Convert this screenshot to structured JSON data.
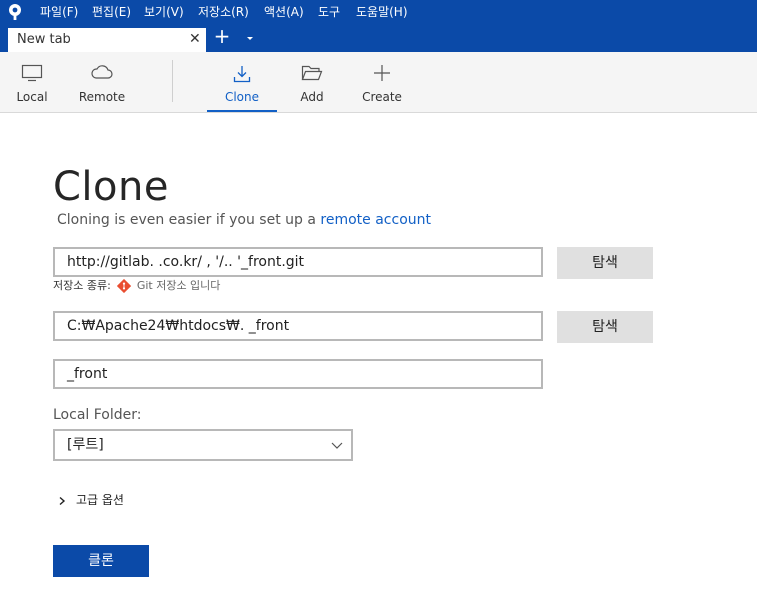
{
  "menu": {
    "file": "파일(F)",
    "edit": "편집(E)",
    "view": "보기(V)",
    "repository": "저장소(R)",
    "actions": "액션(A)",
    "tools": "도구",
    "help": "도움말(H)"
  },
  "tabs": [
    {
      "label": "New tab"
    }
  ],
  "toolbar": {
    "local": "Local",
    "remote": "Remote",
    "clone": "Clone",
    "add": "Add",
    "create": "Create"
  },
  "clone": {
    "title": "Clone",
    "subtitle_text": "Cloning is even easier if you set up a ",
    "subtitle_link": "remote account",
    "source_url": "http://gitlab.      .co.kr/   ,  '/..  '_front.git",
    "browse_label": "탐색",
    "repo_type_label": "저장소 종류:",
    "repo_type_value": "Git 저장소 입니다",
    "destination_path": "C:₩Apache24₩htdocs₩.      _front",
    "name": "       _front",
    "local_folder_label": "Local Folder:",
    "local_folder_value": "[루트]",
    "advanced_options": "고급 옵션",
    "clone_button": "클론"
  },
  "colors": {
    "brand_blue": "#0b4aa8",
    "link_blue": "#1260c6",
    "git_orange": "#e94e31"
  }
}
